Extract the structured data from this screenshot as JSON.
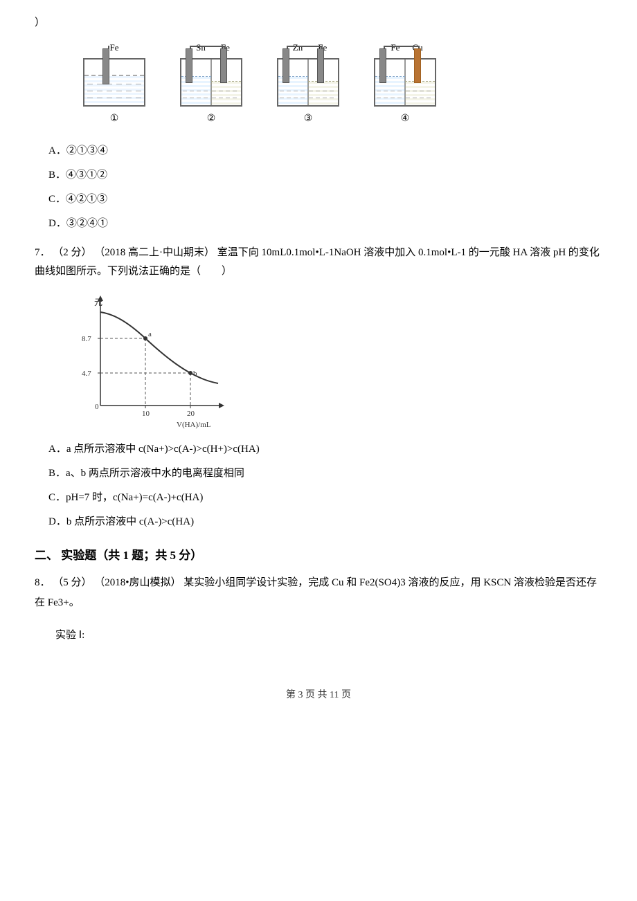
{
  "closing_paren": "）",
  "cells": [
    {
      "id": "cell-1",
      "labels": [
        "Fe"
      ],
      "number": "①",
      "type": "single",
      "has_salt_bridge": false
    },
    {
      "id": "cell-2",
      "labels": [
        "Sn",
        "Fe"
      ],
      "number": "②",
      "type": "double",
      "has_salt_bridge": true
    },
    {
      "id": "cell-3",
      "labels": [
        "Zn",
        "Fe"
      ],
      "number": "③",
      "type": "double",
      "has_salt_bridge": true
    },
    {
      "id": "cell-4",
      "labels": [
        "Fe",
        "Cu"
      ],
      "number": "④",
      "type": "double",
      "has_salt_bridge": true
    }
  ],
  "options_q6": [
    {
      "id": "A",
      "text": "A．②①③④"
    },
    {
      "id": "B",
      "text": "B．④③①②"
    },
    {
      "id": "C",
      "text": "C．④②①③"
    },
    {
      "id": "D",
      "text": "D．③②④①"
    }
  ],
  "question_7": {
    "number": "7．",
    "score": "（2 分）",
    "source": "（2018 高二上·中山期末）",
    "text": "室温下向 10mL0.1mol•L-1NaOH 溶液中加入 0.1mol•L-1 的一元酸 HA 溶液 pH 的变化曲线如图所示。下列说法正确的是（　　）",
    "chart": {
      "y_label": "元",
      "x_label": "V(HA)/mL",
      "y_values": [
        "8.7",
        "4.7"
      ],
      "x_values": [
        "0",
        "10",
        "20"
      ],
      "point_a_label": "a",
      "point_b_label": "b"
    },
    "options": [
      {
        "id": "A",
        "text": "A．a 点所示溶液中 c(Na+)>c(A-)>c(H+)>c(HA)"
      },
      {
        "id": "B",
        "text": "B．a、b 两点所示溶液中水的电离程度相同"
      },
      {
        "id": "C",
        "text": "C．pH=7 时，c(Na+)=c(A-)+c(HA)"
      },
      {
        "id": "D",
        "text": "D．b 点所示溶液中 c(A-)>c(HA)"
      }
    ]
  },
  "section_2": {
    "title": "二、  实验题（共 1 题；共 5 分）"
  },
  "question_8": {
    "number": "8．",
    "score": "（5 分）",
    "source": "（2018•房山模拟）",
    "text": "某实验小组同学设计实验，完成 Cu 和 Fe2(SO4)3 溶液的反应，用 KSCN 溶液检验是否还存在 Fe3+。",
    "experiment_label": "实验 Ⅰ:"
  },
  "footer": {
    "text": "第 3 页  共 11 页"
  }
}
